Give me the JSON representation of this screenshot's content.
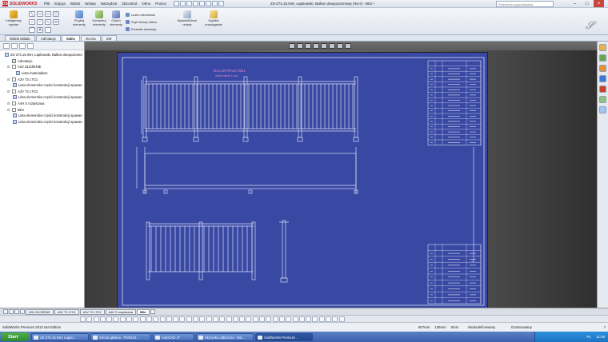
{
  "app": {
    "brand": "SOLIDWORKS",
    "menu": [
      "Plik",
      "Edycja",
      "Widok",
      "Wstaw",
      "Narzędzia",
      "3Dcontrol",
      "Okno",
      "Pomoc"
    ],
    "document_title": "ZS-274.15.INH, Łapkowski, Balkon dwupoziomowy (IN.H) - BDx *",
    "search_placeholder": "Polecenia wyszukiwania"
  },
  "ribbon": {
    "buttons": [
      {
        "label": "Inteligentny\nwymiar",
        "icon": "smart-dimension-icon"
      },
      {
        "label": "Przytnij\nelementy",
        "icon": "trim-icon"
      },
      {
        "label": "Konwertuj\nelementy",
        "icon": "convert-icon"
      },
      {
        "label": "Odsuń\nelementy",
        "icon": "offset-icon"
      },
      {
        "label": "Wyświetl/Usuń\nrelacje",
        "icon": "relations-icon"
      },
      {
        "label": "Szybkie\nprzyciąganie",
        "icon": "snap-icon"
      }
    ],
    "small": [
      "Lustro elementów",
      "Szyk liniowy szkicu",
      "Przenieś elementy"
    ]
  },
  "tabs": [
    "Widok układu",
    "Adnotacje",
    "Szkic",
    "Ocena",
    "SW"
  ],
  "active_tab": "Szkic",
  "tree": [
    {
      "label": "ZS-274.15.INH, Łapkowski, Balkon dwupoziomowy",
      "indent": 0,
      "type": "doc"
    },
    {
      "label": "Adnotacje",
      "indent": 1,
      "type": "folder"
    },
    {
      "label": "A3V ZŁOŻENIE",
      "indent": 1,
      "type": "sheet"
    },
    {
      "label": "Lista materiałów1",
      "indent": 2,
      "type": "doc"
    },
    {
      "label": "A3V T2 LTG1",
      "indent": 1,
      "type": "sheet"
    },
    {
      "label": "Lista elementów części konstrukcji spawanej",
      "indent": 2,
      "type": "doc"
    },
    {
      "label": "A3V T2 LTG2",
      "indent": 1,
      "type": "sheet"
    },
    {
      "label": "Lista elementów części konstrukcji spawanej",
      "indent": 2,
      "type": "doc"
    },
    {
      "label": "A4H S rozpiszana",
      "indent": 1,
      "type": "sheet"
    },
    {
      "label": "BDx",
      "indent": 1,
      "type": "sheet"
    },
    {
      "label": "Lista elementów części konstrukcji spawanej",
      "indent": 2,
      "type": "doc"
    },
    {
      "label": "Lista elementów części konstrukcji spawanej",
      "indent": 2,
      "type": "doc"
    }
  ],
  "drawing": {
    "title": "BALUSTRADA BD1",
    "subtitle": "Wykonanie 1 szt."
  },
  "bom_top_rows": 16,
  "bom_bottom_rows": 10,
  "sheet_tabs": [
    "A3V ZŁOŻENIE",
    "A3V T2 LTG1",
    "A3V T2 LTG2",
    "A4H S rozpiszana",
    "BDx"
  ],
  "active_sheet": "BDx",
  "status": {
    "product": "SolidWorks Premium 2013 x64 Edition",
    "x": "807mm",
    "y": "135mm",
    "z": "0mm",
    "state": "Niedodefiniowany",
    "mode": "Dostosowany",
    "units": "ZMW"
  },
  "taskbar": {
    "start": "Start",
    "items": [
      "ZS-274.15.INH, Łapko...",
      "Strona główna - PSWUG...",
      "AutoCAD LT",
      "Skrzynka odbiorcza - Mic...",
      "SolidWorks Premium ..."
    ],
    "active_index": 4,
    "lang": "PL",
    "clock": "11:49"
  },
  "colors": {
    "sheet_background": "#3949a3",
    "drawing_lines": "#d9dcf5",
    "title_text": "#d88ad0"
  }
}
